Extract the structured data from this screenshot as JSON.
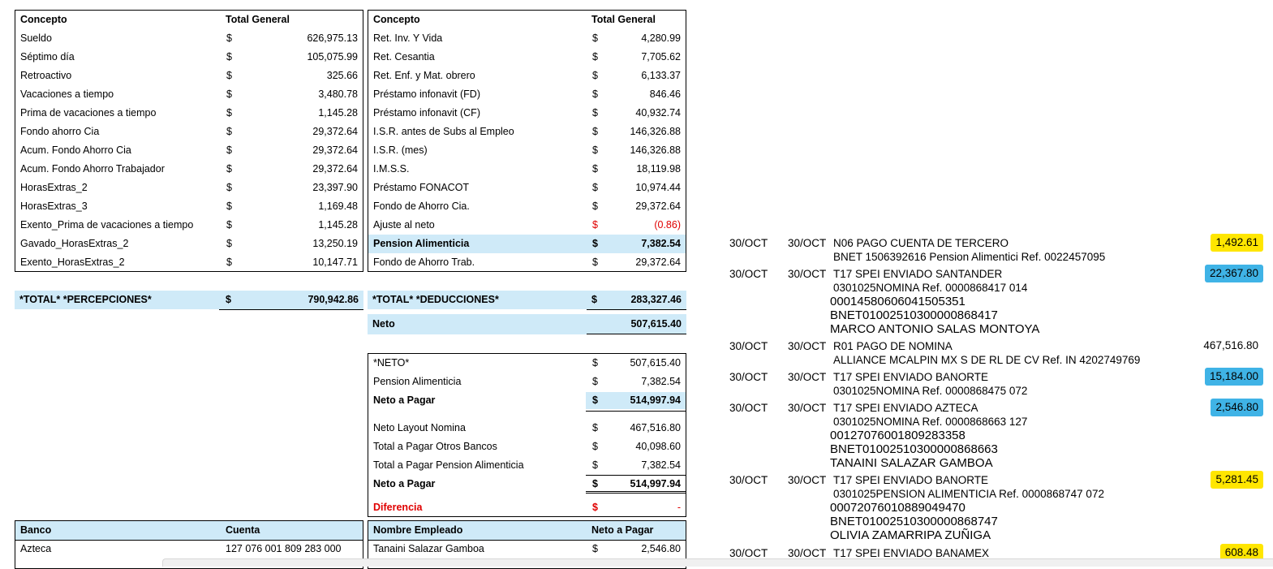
{
  "percepciones": {
    "header": {
      "concepto": "Concepto",
      "total": "Total General"
    },
    "rows": [
      {
        "label": "Sueldo",
        "cur": "$",
        "amount": "626,975.13"
      },
      {
        "label": "Séptimo día",
        "cur": "$",
        "amount": "105,075.99"
      },
      {
        "label": "Retroactivo",
        "cur": "$",
        "amount": "325.66"
      },
      {
        "label": "Vacaciones a tiempo",
        "cur": "$",
        "amount": "3,480.78"
      },
      {
        "label": "Prima de vacaciones a tiempo",
        "cur": "$",
        "amount": "1,145.28"
      },
      {
        "label": "Fondo ahorro Cia",
        "cur": "$",
        "amount": "29,372.64"
      },
      {
        "label": "Acum. Fondo Ahorro Cia",
        "cur": "$",
        "amount": "29,372.64"
      },
      {
        "label": "Acum. Fondo Ahorro Trabajador",
        "cur": "$",
        "amount": "29,372.64"
      },
      {
        "label": "HorasExtras_2",
        "cur": "$",
        "amount": "23,397.90"
      },
      {
        "label": "HorasExtras_3",
        "cur": "$",
        "amount": "1,169.48"
      },
      {
        "label": "Exento_Prima de vacaciones a tiempo",
        "cur": "$",
        "amount": "1,145.28"
      },
      {
        "label": "Gavado_HorasExtras_2",
        "cur": "$",
        "amount": "13,250.19"
      },
      {
        "label": "Exento_HorasExtras_2",
        "cur": "$",
        "amount": "10,147.71"
      }
    ],
    "total": {
      "label": "*TOTAL* *PERCEPCIONES*",
      "cur": "$",
      "amount": "790,942.86"
    }
  },
  "deducciones": {
    "header": {
      "concepto": "Concepto",
      "total": "Total General"
    },
    "rows": [
      {
        "label": "Ret. Inv. Y Vida",
        "cur": "$",
        "amount": "4,280.99"
      },
      {
        "label": "Ret. Cesantia",
        "cur": "$",
        "amount": "7,705.62"
      },
      {
        "label": "Ret. Enf. y Mat. obrero",
        "cur": "$",
        "amount": "6,133.37"
      },
      {
        "label": "Préstamo infonavit (FD)",
        "cur": "$",
        "amount": "846.46"
      },
      {
        "label": "Préstamo infonavit (CF)",
        "cur": "$",
        "amount": "40,932.74"
      },
      {
        "label": "I.S.R. antes de Subs al Empleo",
        "cur": "$",
        "amount": "146,326.88"
      },
      {
        "label": "I.S.R. (mes)",
        "cur": "$",
        "amount": "146,326.88"
      },
      {
        "label": "I.M.S.S.",
        "cur": "$",
        "amount": "18,119.98"
      },
      {
        "label": "Préstamo FONACOT",
        "cur": "$",
        "amount": "10,974.44"
      },
      {
        "label": "Fondo de Ahorro Cia.",
        "cur": "$",
        "amount": "29,372.64"
      },
      {
        "label": "Ajuste al neto",
        "cur": "$",
        "amount": "(0.86)"
      },
      {
        "label": "Pension Alimenticia",
        "cur": "$",
        "amount": "7,382.54"
      },
      {
        "label": "Fondo de Ahorro Trab.",
        "cur": "$",
        "amount": "29,372.64"
      }
    ],
    "total": {
      "label": "*TOTAL* *DEDUCCIONES*",
      "cur": "$",
      "amount": "283,327.46"
    },
    "neto": {
      "label": "Neto",
      "amount": "507,615.40"
    }
  },
  "resumen": {
    "rows": [
      {
        "label": "*NETO*",
        "cur": "$",
        "amount": "507,615.40"
      },
      {
        "label": "Pension Alimenticia",
        "cur": "$",
        "amount": "7,382.54"
      },
      {
        "label": "Neto a Pagar",
        "cur": "$",
        "amount": "514,997.94"
      },
      {
        "label": "Neto Layout Nomina",
        "cur": "$",
        "amount": "467,516.80"
      },
      {
        "label": "Total a Pagar Otros Bancos",
        "cur": "$",
        "amount": "40,098.60"
      },
      {
        "label": "Total a Pagar Pension Alimenticia",
        "cur": "$",
        "amount": "7,382.54"
      },
      {
        "label": "Neto a Pagar",
        "cur": "$",
        "amount": "514,997.94"
      },
      {
        "label": "Diferencia",
        "cur": "$",
        "amount": "-"
      }
    ]
  },
  "bancos": {
    "header": {
      "banco": "Banco",
      "cuenta": "Cuenta"
    },
    "rows": [
      {
        "banco": "Azteca",
        "cuenta": "127 076 001 809 283 000"
      }
    ]
  },
  "empleados": {
    "header": {
      "nombre": "Nombre Empleado",
      "neto": "Neto a Pagar"
    },
    "rows": [
      {
        "nombre": "Tanaini Salazar Gamboa",
        "cur": "$",
        "amount": "2,546.80"
      }
    ]
  },
  "estado_cuenta": [
    {
      "fecha1": "30/OCT",
      "fecha2": "30/OCT",
      "desc": "N06 PAGO CUENTA DE TERCERO",
      "extra": [
        "BNET 1506392616 Pension Alimentici Ref. 0022457095"
      ],
      "accounts": [],
      "amount": "1,492.61",
      "highlight": "yellow"
    },
    {
      "fecha1": "30/OCT",
      "fecha2": "30/OCT",
      "desc": "T17 SPEI ENVIADO SANTANDER",
      "extra": [
        "0301025NOMINA Ref. 0000868417 014"
      ],
      "accounts": [
        "00014580606041505351",
        "BNET01002510300000868417",
        "MARCO ANTONIO SALAS MONTOYA"
      ],
      "amount": "22,367.80",
      "highlight": "blue"
    },
    {
      "fecha1": "30/OCT",
      "fecha2": "30/OCT",
      "desc": "R01 PAGO DE NOMINA",
      "extra": [
        "ALLIANCE MCALPIN MX S DE RL DE CV Ref. IN 4202749769"
      ],
      "accounts": [],
      "amount": "467,516.80",
      "highlight": "none"
    },
    {
      "fecha1": "30/OCT",
      "fecha2": "30/OCT",
      "desc": "T17 SPEI ENVIADO BANORTE",
      "extra": [
        "0301025NOMINA Ref. 0000868475 072"
      ],
      "accounts": [],
      "amount": "15,184.00",
      "highlight": "blue"
    },
    {
      "fecha1": "30/OCT",
      "fecha2": "30/OCT",
      "desc": "T17 SPEI ENVIADO AZTECA",
      "extra": [
        "0301025NOMINA Ref. 0000868663 127"
      ],
      "accounts": [
        "00127076001809283358",
        "BNET01002510300000868663",
        "TANAINI SALAZAR GAMBOA"
      ],
      "amount": "2,546.80",
      "highlight": "blue"
    },
    {
      "fecha1": "30/OCT",
      "fecha2": "30/OCT",
      "desc": "T17 SPEI ENVIADO BANORTE",
      "extra": [
        "0301025PENSION ALIMENTICIA Ref. 0000868747 072"
      ],
      "accounts": [
        "00072076010889049470",
        "BNET01002510300000868747",
        "OLIVIA ZAMARRIPA ZUÑIGA"
      ],
      "amount": "5,281.45",
      "highlight": "yellow"
    },
    {
      "fecha1": "30/OCT",
      "fecha2": "30/OCT",
      "desc": "T17 SPEI ENVIADO BANAMEX",
      "extra": [],
      "accounts": [],
      "amount": "608.48",
      "highlight": "yellow"
    }
  ],
  "colors": {
    "highlight_yellow": "#ffe600",
    "highlight_blue": "#3fb3e6",
    "cell_blue": "#cfeaf8",
    "negative_red": "#e00000"
  }
}
